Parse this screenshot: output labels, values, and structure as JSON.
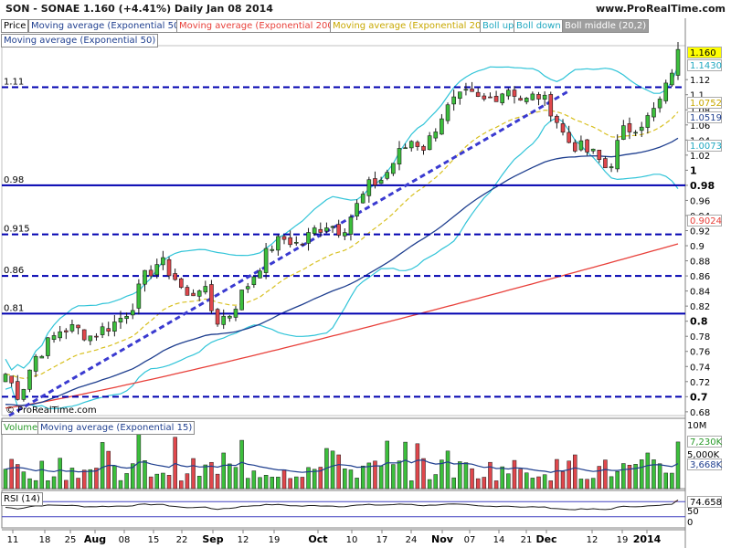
{
  "header": {
    "symbol_line": "SON - SONAE    1.160 (+4.41%)    Daily  Jan 08 2014",
    "site": "www.ProRealTime.com"
  },
  "legend": {
    "price": "Price",
    "ema50": "Moving average (Exponential 50)",
    "ema200": "Moving average (Exponential 200)",
    "ema20": "Moving average (Exponential 20)",
    "boll_up": "Boll up",
    "boll_down": "Boll down",
    "boll_middle": "Boll middle (20,2)",
    "ema50_second": "Moving average (Exponential 50)",
    "volume": "Volume",
    "vol_ema15": "Moving average (Exponential 15)",
    "rsi": "RSI (14)"
  },
  "price_axis": {
    "ticks": [
      "1.12",
      "1.1",
      "1.08",
      "1.06",
      "1.04",
      "1.02",
      "1",
      "0.98",
      "0.96",
      "0.94",
      "0.92",
      "0.9",
      "0.88",
      "0.86",
      "0.84",
      "0.82",
      "0.8",
      "0.78",
      "0.76",
      "0.74",
      "0.72",
      "0.7",
      "0.68"
    ],
    "bold_ticks": [
      "1",
      "0.98",
      "0.8",
      "0.7"
    ]
  },
  "labels": {
    "last_price": "1.160",
    "boll_up": "1.1430",
    "ema20": "1.0752",
    "ema50": "1.0519",
    "boll_down": "1.0073",
    "ema200": "0.9024",
    "vol_10m": "10M",
    "vol_last": "7,230K",
    "vol_5m": "5,000K",
    "vol_ema": "3,668K",
    "rsi_value": "74.658",
    "rsi_50": "50",
    "rsi_0": "0"
  },
  "hlines": [
    {
      "label": "1.11",
      "style": "dashed"
    },
    {
      "label": "0.98",
      "style": "solid"
    },
    {
      "label": "0.915",
      "style": "dashed"
    },
    {
      "label": "0.86",
      "style": "dashed"
    },
    {
      "label": "0.81",
      "style": "solid"
    },
    {
      "label": "",
      "style": "dashed"
    }
  ],
  "x_axis": [
    "11",
    "18",
    "25",
    "Aug",
    "08",
    "15",
    "22",
    "Sep",
    "12",
    "19",
    "Oct",
    "10",
    "17",
    "24",
    "Nov",
    "07",
    "14",
    "21",
    "Dec",
    "12",
    "19",
    "2014"
  ],
  "x_bold": [
    "Aug",
    "Sep",
    "Oct",
    "Nov",
    "Dec",
    "2014"
  ],
  "watermark": "© ProRealTime.com",
  "colors": {
    "up": "#3cbf3c",
    "down": "#e0474c",
    "ema50": "#1f3f8f",
    "ema200": "#e8403a",
    "ema20": "#d8c020",
    "boll": "#30c4d8",
    "hline": "#0000b0",
    "trend": "#3a3ad0"
  },
  "chart_data": {
    "type": "candlestick",
    "interval": "Daily",
    "ylim": [
      0.675,
      1.165
    ],
    "x_ticks": [
      "11",
      "18",
      "25",
      "Aug",
      "08",
      "15",
      "22",
      "Sep",
      "12",
      "19",
      "Oct",
      "10",
      "17",
      "24",
      "Nov",
      "07",
      "14",
      "21",
      "Dec",
      "12",
      "19",
      "2014"
    ],
    "horizontal_levels": [
      1.11,
      0.98,
      0.915,
      0.86,
      0.81,
      0.7
    ],
    "trendline": {
      "start": 0.675,
      "end": 1.105
    },
    "close_path": [
      0.73,
      0.7,
      0.75,
      0.77,
      0.79,
      0.79,
      0.78,
      0.79,
      0.8,
      0.82,
      0.86,
      0.88,
      0.86,
      0.83,
      0.85,
      0.8,
      0.81,
      0.84,
      0.87,
      0.9,
      0.91,
      0.9,
      0.92,
      0.93,
      0.92,
      0.95,
      0.98,
      0.99,
      1.02,
      1.04,
      1.03,
      1.07,
      1.09,
      1.1,
      1.09,
      1.1,
      1.11,
      1.09,
      1.1,
      1.08,
      1.04,
      1.03,
      1.02,
      1.0,
      1.05,
      1.06,
      1.07,
      1.1,
      1.16
    ],
    "series": [
      {
        "name": "Moving average (Exponential 50)",
        "last": 1.0519
      },
      {
        "name": "Moving average (Exponential 200)",
        "last": 0.9024
      },
      {
        "name": "Moving average (Exponential 20)",
        "last": 1.0752
      },
      {
        "name": "Boll up",
        "last": 1.143
      },
      {
        "name": "Boll down",
        "last": 1.0073
      }
    ],
    "last_close": 1.16,
    "change_pct": 4.41,
    "volume": {
      "ylim_label": "10M",
      "last": 7230,
      "ema15": 3668,
      "unit": "K"
    },
    "rsi": {
      "period": 14,
      "last": 74.658
    }
  }
}
